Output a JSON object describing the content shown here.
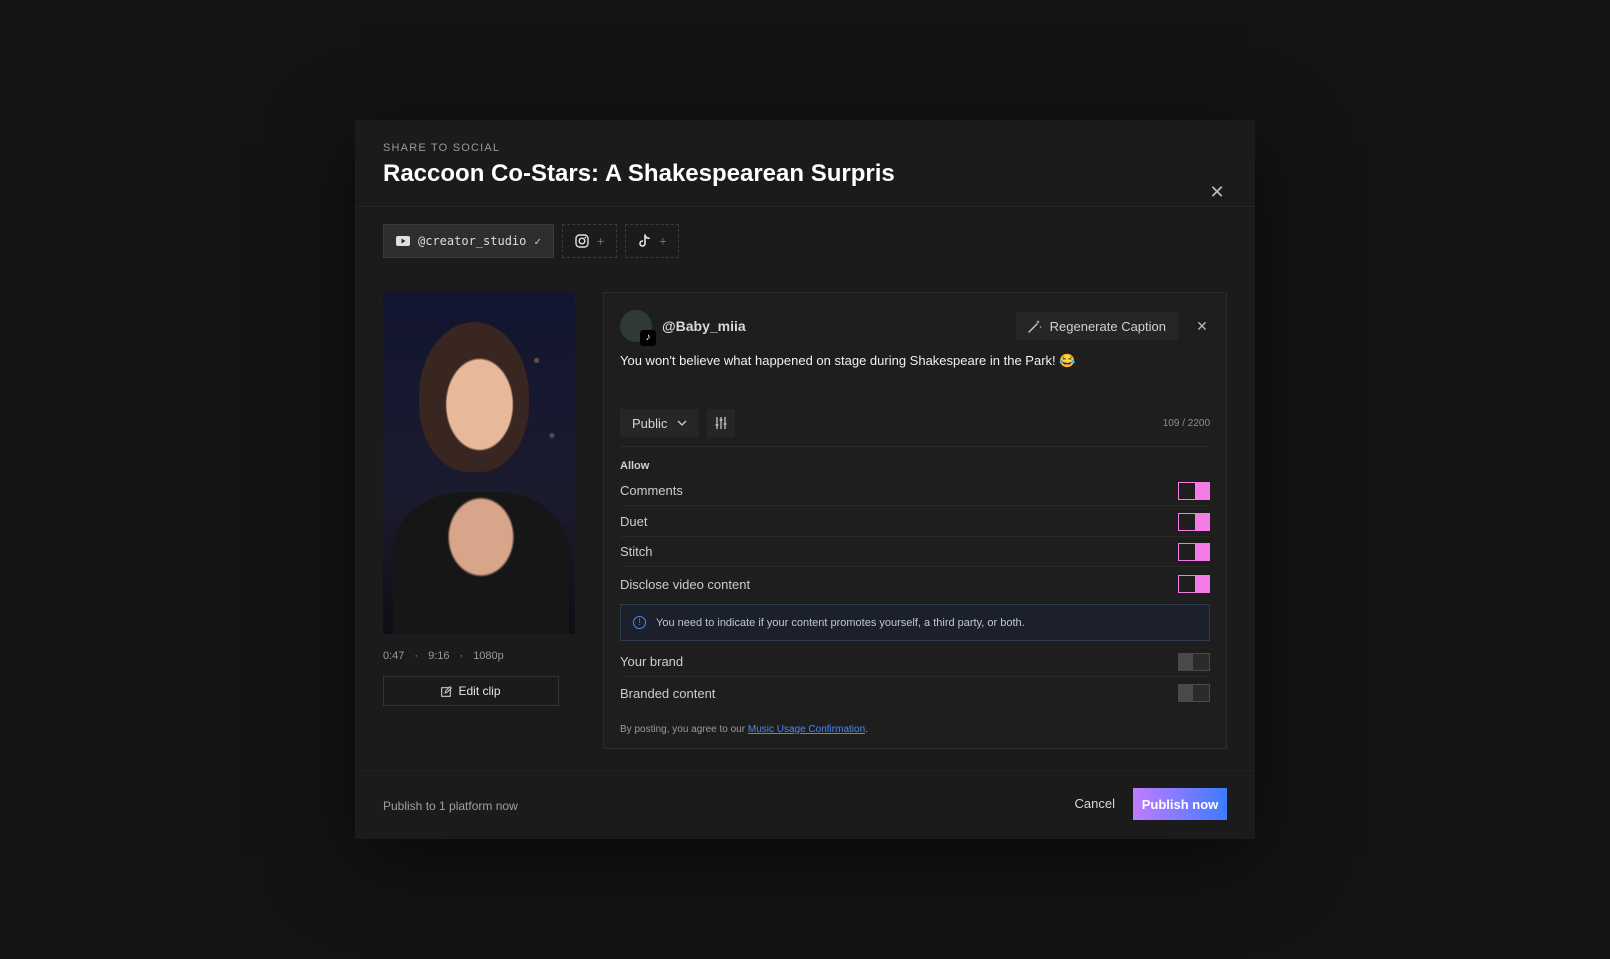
{
  "modal": {
    "eyebrow": "SHARE TO SOCIAL",
    "title": "Raccoon Co-Stars: A Shakespearean Surpris"
  },
  "accounts": [
    {
      "platform": "youtube",
      "label": "@creator_studio",
      "connected": true
    },
    {
      "platform": "instagram",
      "connected": false
    },
    {
      "platform": "tiktok",
      "connected": false
    }
  ],
  "clip": {
    "duration": "0:47",
    "aspect": "9:16",
    "resolution": "1080p",
    "edit_label": "Edit clip"
  },
  "post": {
    "handle": "@Baby_miia",
    "regenerate_label": "Regenerate Caption",
    "caption": "You won't believe what happened on stage during Shakespeare in the Park! 😂",
    "visibility": "Public",
    "char_count": "109 / 2200",
    "allow_title": "Allow",
    "toggles": [
      {
        "label": "Comments",
        "on": true
      },
      {
        "label": "Duet",
        "on": true
      },
      {
        "label": "Stitch",
        "on": true
      },
      {
        "label": "Disclose video content",
        "on": true
      }
    ],
    "notice": "You need to indicate if your content promotes yourself, a third party, or both.",
    "sub_toggles": [
      {
        "label": "Your brand",
        "on": false
      },
      {
        "label": "Branded content",
        "on": false
      }
    ],
    "legal_prefix": "By posting, you agree to our ",
    "legal_link": "Music Usage Confirmation",
    "legal_suffix": "."
  },
  "footer": {
    "status": "Publish to 1 platform now",
    "cancel_label": "Cancel",
    "publish_label": "Publish now"
  },
  "colors": {
    "toggle_on": "#f57be6",
    "accent_blue": "#4f86f0"
  }
}
